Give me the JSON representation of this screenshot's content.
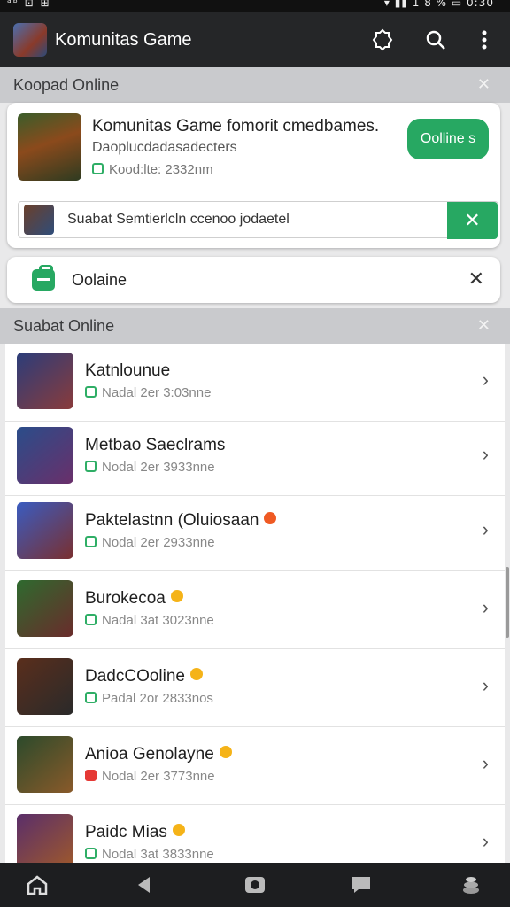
{
  "status": {
    "left": "ᵃᵇ ⊡ ⊞",
    "right": "▾ ▮▮ 1 8 % ▭ 0:30"
  },
  "header": {
    "title": "Komunitas Game"
  },
  "top_section": {
    "label": "Koopad Online"
  },
  "featured": {
    "title": "Komunitas Game fomorit cmedbames.",
    "subtitle": "Daoplucdadasadecters",
    "meta": "Kood:lte: 2332nm",
    "button_label": "Oolline s",
    "banner_text": "Suabat Semtierlcln ccenoo jodaetel"
  },
  "notice": {
    "label": "Oolaine"
  },
  "list_section": {
    "label": "Suabat Online"
  },
  "items": [
    {
      "name": "Katnlounue",
      "meta": "Nadal 2er 3:03nne",
      "emoji": false,
      "badge": "green",
      "colors": [
        "#2b3d7a",
        "#8a3b3b"
      ]
    },
    {
      "name": "Metbao Saeclrams",
      "meta": "Nodal 2er 3933nne",
      "emoji": false,
      "badge": "green",
      "colors": [
        "#2a4d8a",
        "#6a2f6a"
      ]
    },
    {
      "name": "Paktelastnn (Oluiosaan",
      "meta": "Nodal 2er 2933nne",
      "emoji": true,
      "emoji_color": "hot",
      "badge": "green",
      "colors": [
        "#3a5cc0",
        "#7a2f2f"
      ]
    },
    {
      "name": "Burokecoa",
      "meta": "Nadal 3at 3023nne",
      "emoji": true,
      "badge": "green",
      "colors": [
        "#2e6a2e",
        "#6a2b2b"
      ]
    },
    {
      "name": "DadcCOoline",
      "meta": "Padal 2or 2833nos",
      "emoji": true,
      "badge": "green",
      "colors": [
        "#5a2e1c",
        "#2a2a2a"
      ]
    },
    {
      "name": "Anioa Genolayne",
      "meta": "Nodal 2er 3773nne",
      "emoji": true,
      "badge": "red",
      "colors": [
        "#2b4a2b",
        "#8a5a2a"
      ]
    },
    {
      "name": "Paidc Mias",
      "meta": "Nodal 3at 3833nne",
      "emoji": true,
      "badge": "green",
      "colors": [
        "#5a2e6a",
        "#a05a2a"
      ]
    }
  ]
}
